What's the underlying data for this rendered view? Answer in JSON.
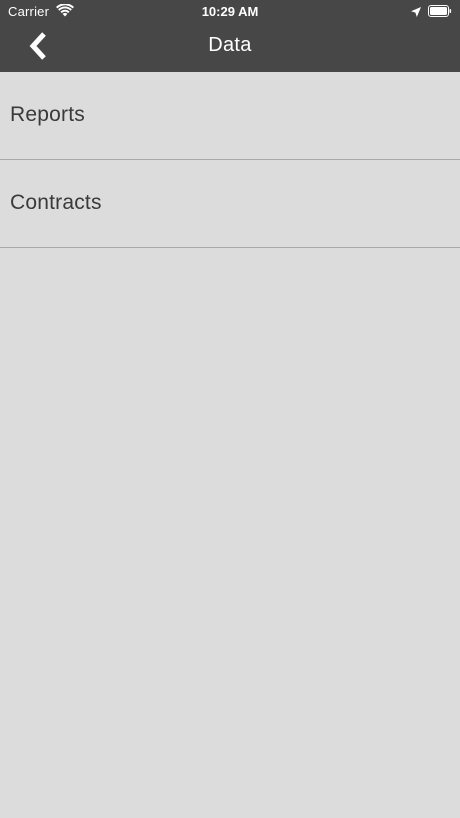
{
  "status_bar": {
    "carrier": "Carrier",
    "time": "10:29 AM",
    "icons": [
      "wifi-icon",
      "location-arrow-icon",
      "battery-icon"
    ]
  },
  "nav": {
    "title": "Data",
    "back_icon": "chevron-left-icon"
  },
  "list": {
    "items": [
      {
        "label": "Reports"
      },
      {
        "label": "Contracts"
      }
    ]
  },
  "colors": {
    "nav_background": "#474747",
    "page_background": "#dcdcdc",
    "divider": "#a9a9a9",
    "text": "#3a3a3a"
  }
}
